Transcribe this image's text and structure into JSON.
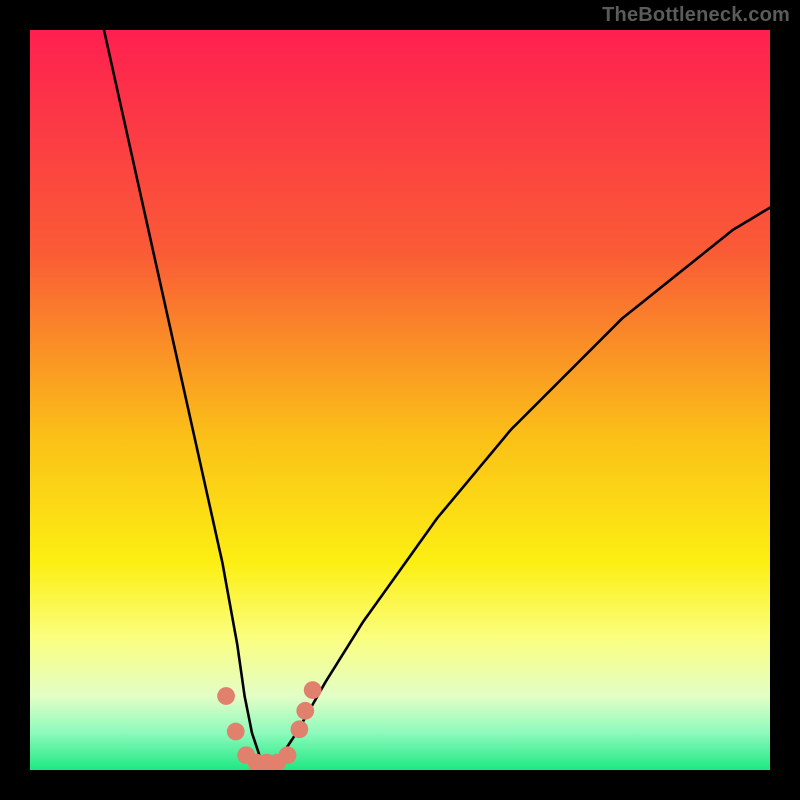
{
  "watermark": "TheBottleneck.com",
  "chart_data": {
    "type": "line",
    "title": "",
    "xlabel": "",
    "ylabel": "",
    "xlim": [
      0,
      100
    ],
    "ylim": [
      0,
      100
    ],
    "gradient_stops": [
      {
        "pos": 0.0,
        "color": "#fe2050"
      },
      {
        "pos": 0.3,
        "color": "#fa5b36"
      },
      {
        "pos": 0.55,
        "color": "#fbc018"
      },
      {
        "pos": 0.72,
        "color": "#fcef13"
      },
      {
        "pos": 0.82,
        "color": "#fbfe7e"
      },
      {
        "pos": 0.9,
        "color": "#e3fec6"
      },
      {
        "pos": 0.95,
        "color": "#8dfabc"
      },
      {
        "pos": 1.0,
        "color": "#1de883"
      }
    ],
    "series": [
      {
        "name": "bottleneck-curve",
        "x": [
          10,
          12,
          14,
          16,
          18,
          20,
          22,
          24,
          26,
          28,
          29,
          30,
          31,
          32,
          33,
          34,
          36,
          40,
          45,
          50,
          55,
          60,
          65,
          70,
          75,
          80,
          85,
          90,
          95,
          100
        ],
        "y": [
          100,
          91,
          82,
          73,
          64,
          55,
          46,
          37,
          28,
          17,
          10,
          5,
          2,
          1,
          1,
          2,
          5,
          12,
          20,
          27,
          34,
          40,
          46,
          51,
          56,
          61,
          65,
          69,
          73,
          76
        ]
      }
    ],
    "markers": {
      "color": "#e0806d",
      "radius_pct": 1.2,
      "points": [
        {
          "x": 26.5,
          "y": 10.0
        },
        {
          "x": 27.8,
          "y": 5.2
        },
        {
          "x": 29.2,
          "y": 2.0
        },
        {
          "x": 30.6,
          "y": 1.0
        },
        {
          "x": 32.0,
          "y": 1.0
        },
        {
          "x": 33.4,
          "y": 1.0
        },
        {
          "x": 34.8,
          "y": 2.0
        },
        {
          "x": 36.4,
          "y": 5.5
        },
        {
          "x": 37.2,
          "y": 8.0
        },
        {
          "x": 38.2,
          "y": 10.8
        }
      ]
    }
  }
}
